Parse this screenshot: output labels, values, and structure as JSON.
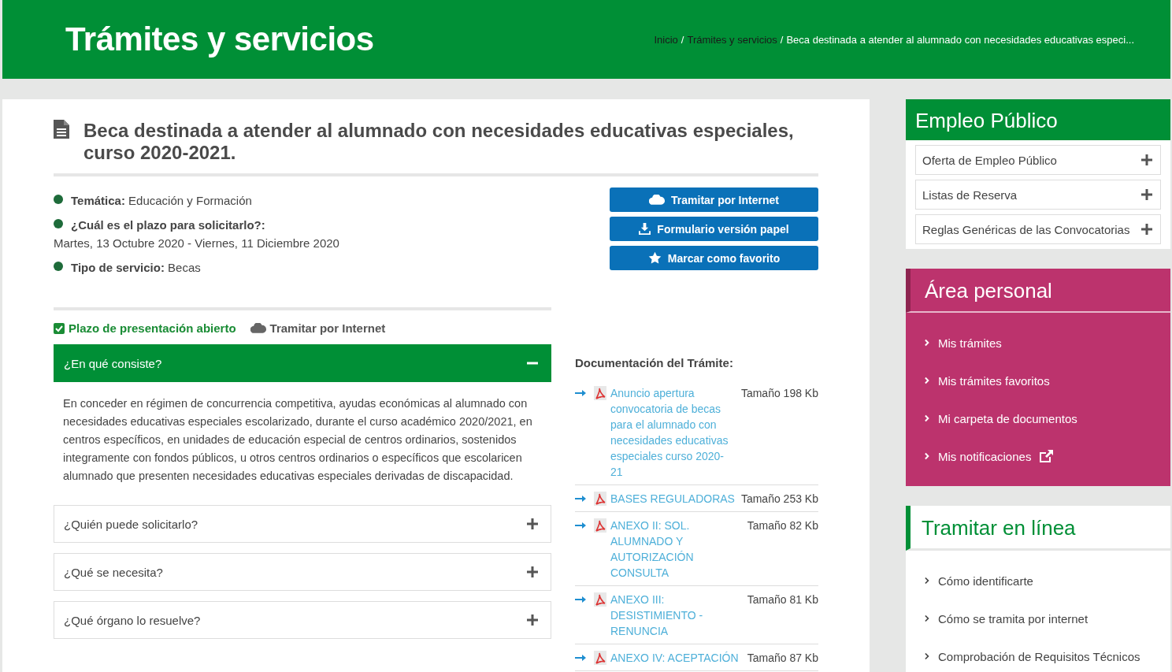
{
  "header": {
    "title": "Trámites y servicios",
    "breadcrumb": [
      {
        "label": "Inicio",
        "kind": "link"
      },
      {
        "label": "Trámites y servicios",
        "kind": "link"
      },
      {
        "label": "Beca destinada a atender al alumnado con necesidades educativas especi...",
        "kind": "current"
      }
    ],
    "separator": "/"
  },
  "page": {
    "title": "Beca destinada a atender al alumnado con necesidades educativas especiales, curso 2020-2021.",
    "facts": [
      {
        "label": "Temática:",
        "value": "Educación y Formación",
        "kind": "inline"
      },
      {
        "label": "¿Cuál es el plazo para solicitarlo?:",
        "value": "Martes, 13 Octubre 2020 - Viernes, 11 Diciembre 2020",
        "kind": "stacked"
      },
      {
        "label": "Tipo de servicio:",
        "value": "Becas",
        "kind": "inline"
      }
    ],
    "actions": [
      "Tramitar por Internet",
      "Formulario versión papel",
      "Marcar como favorito"
    ],
    "status": [
      "Plazo de presentación abierto",
      "Tramitar por Internet"
    ],
    "accordion": [
      {
        "title": "¿En qué consiste?",
        "expanded": true,
        "body": "En conceder en régimen de concurrencia competitiva, ayudas económicas al alumnado con necesidades educativas especiales escolarizado, durante el curso académico 2020/2021, en centros específicos, en unidades de educación especial de centros ordinarios, sostenidos integramente con fondos públicos, u otros centros ordinarios o específicos que escolaricen alumnado que presenten necesidades educativas especiales derivadas de discapacidad."
      },
      {
        "title": "¿Quién puede solicitarlo?",
        "expanded": false
      },
      {
        "title": "¿Qué se necesita?",
        "expanded": false
      },
      {
        "title": "¿Qué órgano lo resuelve?",
        "expanded": false
      }
    ],
    "documents": {
      "title": "Documentación del Trámite:",
      "items": [
        {
          "name": "Anuncio apertura convocatoria de becas para el alumnado con necesidades educativas especiales curso 2020-21",
          "size": "Tamaño 198 Kb"
        },
        {
          "name": "BASES REGULADORAS",
          "size": "Tamaño 253 Kb"
        },
        {
          "name": "ANEXO II: SOL. ALUMNADO Y AUTORIZACIÓN CONSULTA",
          "size": "Tamaño 82 Kb"
        },
        {
          "name": "ANEXO III: DESISTIMIENTO -RENUNCIA",
          "size": "Tamaño 81 Kb"
        },
        {
          "name": "ANEXO IV: ACEPTACIÓN",
          "size": "Tamaño 87 Kb"
        }
      ]
    }
  },
  "sidebar": [
    {
      "kind": "accordion",
      "title": "Empleo Público",
      "items": [
        "Oferta de Empleo Público",
        "Listas de Reserva",
        "Reglas Genéricas de las Convocatorias"
      ]
    },
    {
      "kind": "personal",
      "title": "Área personal",
      "items": [
        {
          "label": "Mis trámites",
          "external": false
        },
        {
          "label": "Mis trámites favoritos",
          "external": false
        },
        {
          "label": "Mi carpeta de documentos",
          "external": false
        },
        {
          "label": "Mis notificaciones",
          "external": true
        }
      ]
    },
    {
      "kind": "links",
      "title": "Tramitar en línea",
      "items": [
        "Cómo identificarte",
        "Cómo se tramita por internet",
        "Comprobación de Requisitos Técnicos"
      ]
    }
  ]
}
